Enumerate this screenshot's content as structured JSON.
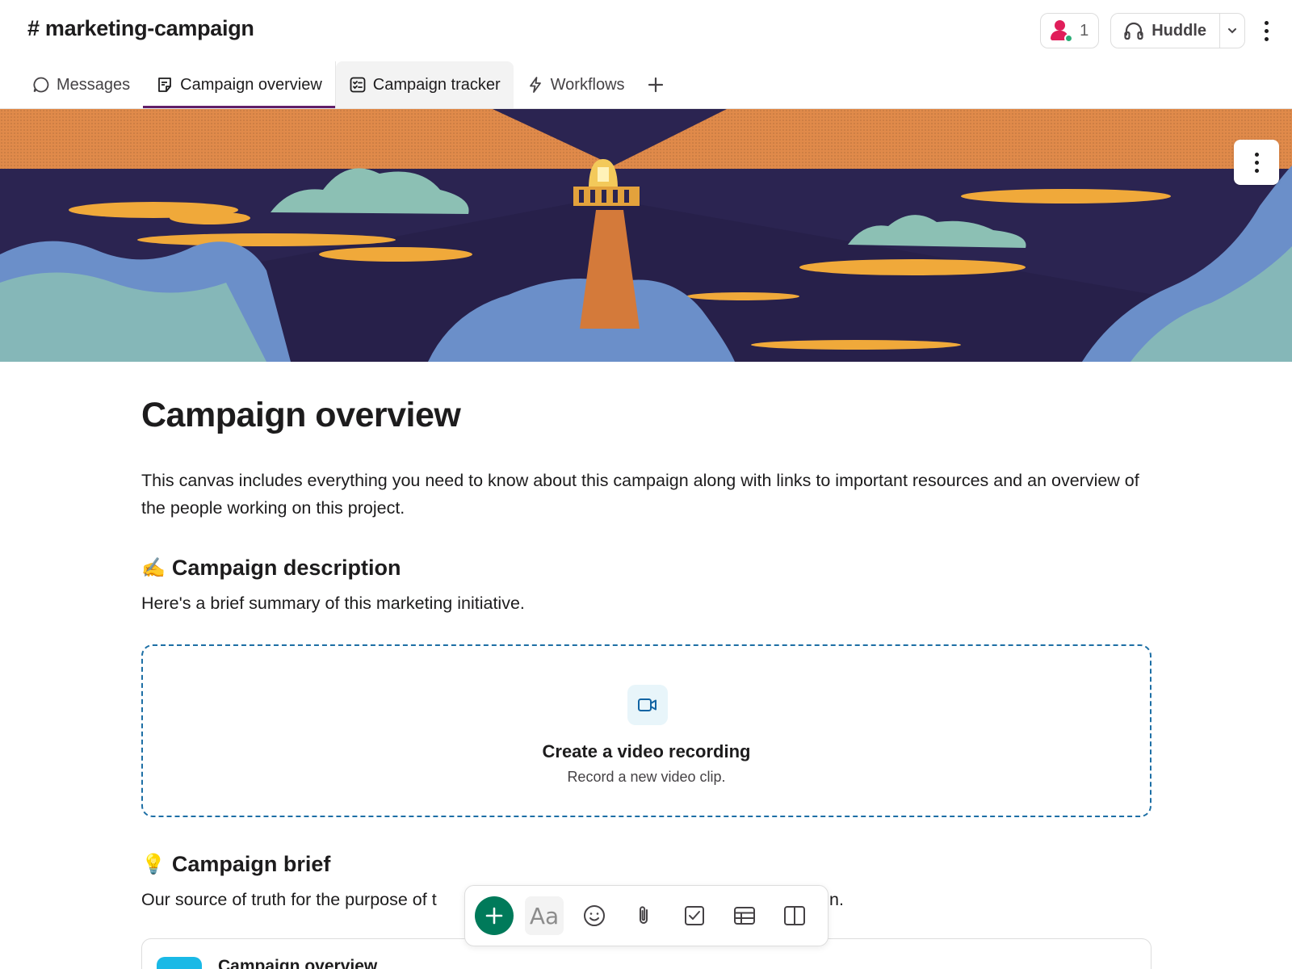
{
  "header": {
    "channel_name": "# marketing-campaign",
    "members_count": "1",
    "huddle_label": "Huddle"
  },
  "tabs": [
    {
      "label": "Messages",
      "icon": "message-bubble-icon",
      "state": "default"
    },
    {
      "label": "Campaign overview",
      "icon": "canvas-icon",
      "state": "active"
    },
    {
      "label": "Campaign tracker",
      "icon": "list-checklist-icon",
      "state": "hover"
    },
    {
      "label": "Workflows",
      "icon": "lightning-icon",
      "state": "default"
    }
  ],
  "canvas": {
    "title": "Campaign overview",
    "intro": "This canvas includes everything you need to know about this campaign along with links to important resources and an overview of the people working on this project.",
    "sections": [
      {
        "emoji": "✍️",
        "heading": "Campaign description",
        "text": "Here's a brief summary of this marketing initiative."
      },
      {
        "emoji": "💡",
        "heading": "Campaign brief",
        "text_left": "Our source of truth for the purpose of t",
        "text_right": "n."
      }
    ],
    "video_block": {
      "title": "Create a video recording",
      "subtitle": "Record a new video clip."
    },
    "card": {
      "title": "Campaign overview"
    }
  },
  "toolbar": {
    "format_label": "Aa",
    "items": [
      "plus-icon",
      "text-format-icon",
      "emoji-icon",
      "attachment-icon",
      "checkbox-icon",
      "table-icon",
      "columns-icon"
    ]
  },
  "colors": {
    "active_tab_underline": "#611f69",
    "primary_green": "#007a5a",
    "dashed_border": "#1d6fa5",
    "banner_sky": "#e08a4a",
    "banner_night": "#2b2451",
    "lighthouse": "#d47a3a"
  }
}
